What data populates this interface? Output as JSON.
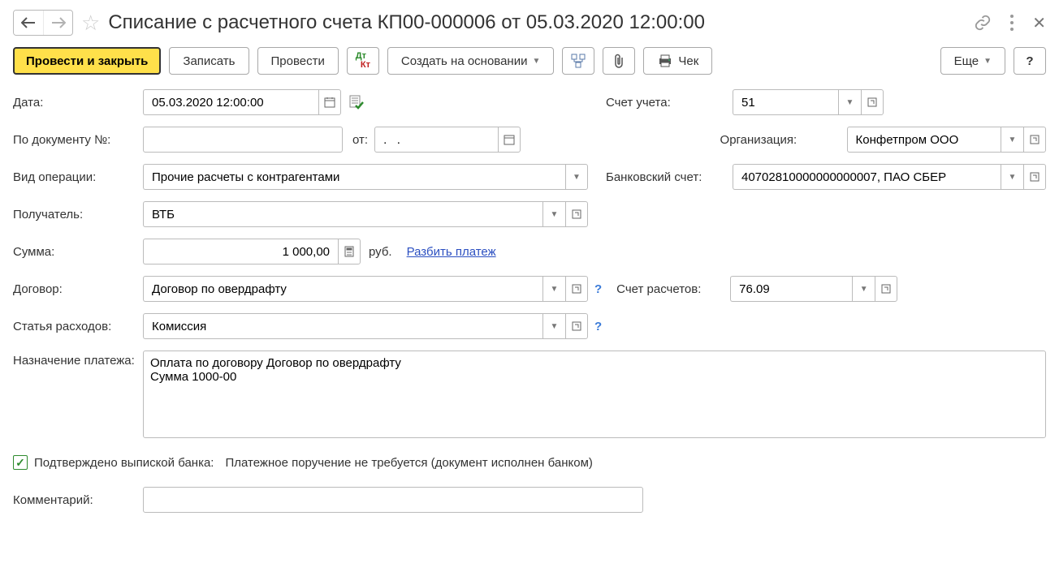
{
  "header": {
    "title": "Списание с расчетного счета КП00-000006 от 05.03.2020 12:00:00"
  },
  "toolbar": {
    "post_close": "Провести и закрыть",
    "save": "Записать",
    "post": "Провести",
    "create_based": "Создать на основании",
    "check": "Чек",
    "more": "Еще",
    "help": "?"
  },
  "labels": {
    "date": "Дата:",
    "doc_no": "По документу №:",
    "from": "от:",
    "op_type": "Вид операции:",
    "recipient": "Получатель:",
    "amount": "Сумма:",
    "currency": "руб.",
    "split": "Разбить платеж",
    "contract": "Договор:",
    "expense_item": "Статья расходов:",
    "purpose": "Назначение платежа:",
    "confirmed": "Подтверждено выпиской банка:",
    "confirmed_note": "Платежное поручение не требуется (документ исполнен банком)",
    "comment": "Комментарий:",
    "account": "Счет учета:",
    "org": "Организация:",
    "bank_account": "Банковский счет:",
    "settle_account": "Счет расчетов:"
  },
  "values": {
    "date": "05.03.2020 12:00:00",
    "doc_no": "",
    "from": ".   .",
    "op_type": "Прочие расчеты с контрагентами",
    "recipient": "ВТБ",
    "amount": "1 000,00",
    "contract": "Договор по овердрафту",
    "expense_item": "Комиссия",
    "purpose": "Оплата по договору Договор по овердрафту\nСумма 1000-00",
    "comment": "",
    "account": "51",
    "org": "Конфетпром ООО",
    "bank_account": "40702810000000000007, ПАО СБЕР",
    "settle_account": "76.09"
  }
}
